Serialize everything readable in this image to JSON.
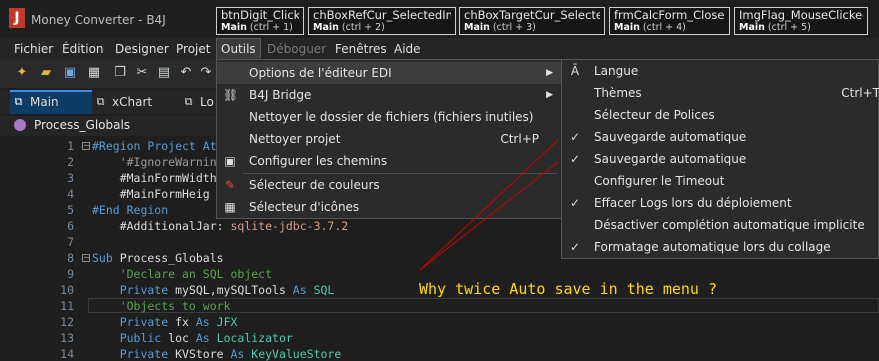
{
  "app": {
    "logo": "J",
    "title": "Money Converter - B4J"
  },
  "quick_tabs": [
    {
      "name": "btnDigit_Click",
      "module": "Main",
      "shortcut": "(ctrl + 1)"
    },
    {
      "name": "chBoxRefCur_SelectedInd",
      "module": "Main",
      "shortcut": "(ctrl + 2)"
    },
    {
      "name": "chBoxTargetCur_SelectedI",
      "module": "Main",
      "shortcut": "(ctrl + 3)"
    },
    {
      "name": "frmCalcForm_Closed",
      "module": "Main",
      "shortcut": "(ctrl + 4)"
    },
    {
      "name": "ImgFlag_MouseClicked",
      "module": "Main",
      "shortcut": "(ctrl + 5)"
    }
  ],
  "menubar": [
    "Fichier",
    "Édition",
    "Designer",
    "Projet",
    "Outils",
    "Déboguer",
    "Fenêtres",
    "Aide"
  ],
  "doc_tabs": [
    "Main",
    "xChart",
    "Lo"
  ],
  "module_name": "Process_Globals",
  "tools_menu": [
    {
      "label": "Options de l'éditeur EDI",
      "submenu": true
    },
    {
      "label": "B4J Bridge",
      "submenu": true,
      "icon": "link-icon"
    },
    {
      "label": "Nettoyer le dossier de fichiers (fichiers inutiles)"
    },
    {
      "label": "Nettoyer projet",
      "shortcut": "Ctrl+P"
    },
    {
      "label": "Configurer les chemins",
      "icon": "paths-icon"
    },
    {
      "label": "Sélecteur de couleurs",
      "icon": "color-picker-icon"
    },
    {
      "label": "Sélecteur d'icônes",
      "icon": "icon-picker-icon"
    }
  ],
  "options_submenu": [
    {
      "label": "Langue",
      "checked": false,
      "icon": "language-icon"
    },
    {
      "label": "Thèmes",
      "checked": false,
      "shortcut": "Ctrl+T"
    },
    {
      "label": "Sélecteur de Polices",
      "checked": false
    },
    {
      "label": "Sauvegarde automatique",
      "checked": true
    },
    {
      "label": "Sauvegarde automatique",
      "checked": true
    },
    {
      "label": "Configurer le Timeout",
      "checked": false
    },
    {
      "label": "Effacer Logs lors du déploiement",
      "checked": true
    },
    {
      "label": "Désactiver complétion automatique implicite",
      "checked": false
    },
    {
      "label": "Formatage automatique lors du collage",
      "checked": true
    }
  ],
  "code_lines": [
    {
      "n": "1",
      "tokens": [
        [
          "#Region ",
          "kw"
        ],
        [
          "Project At",
          "kw"
        ]
      ]
    },
    {
      "n": "2",
      "tokens": [
        [
          "    '#IgnoreWarnin",
          "pp"
        ]
      ]
    },
    {
      "n": "3",
      "tokens": [
        [
          "    #MainFormWidth",
          "pl"
        ]
      ]
    },
    {
      "n": "4",
      "tokens": [
        [
          "    #MainFormHeig",
          "pl"
        ]
      ]
    },
    {
      "n": "5",
      "tokens": [
        [
          "#End Region",
          "kw"
        ]
      ]
    },
    {
      "n": "6",
      "tokens": [
        [
          "    #AdditionalJar: ",
          "pl"
        ],
        [
          "sqlite-jdbc-3.7.2",
          "str"
        ]
      ]
    },
    {
      "n": "7",
      "tokens": []
    },
    {
      "n": "8",
      "tokens": [
        [
          "Sub ",
          "kw"
        ],
        [
          "Process_Globals",
          "pl"
        ]
      ]
    },
    {
      "n": "9",
      "tokens": [
        [
          "    'Declare an SQL object",
          "cm"
        ]
      ]
    },
    {
      "n": "10",
      "tokens": [
        [
          "    Private ",
          "kw"
        ],
        [
          "mySQL,mySQLTools ",
          "pl"
        ],
        [
          "As ",
          "kw"
        ],
        [
          "SQL",
          "ty"
        ]
      ]
    },
    {
      "n": "11",
      "tokens": [
        [
          "    'Objects to work",
          "cm"
        ]
      ]
    },
    {
      "n": "12",
      "tokens": [
        [
          "    Private ",
          "kw"
        ],
        [
          "fx ",
          "pl"
        ],
        [
          "As ",
          "kw"
        ],
        [
          "JFX",
          "ty"
        ]
      ]
    },
    {
      "n": "13",
      "tokens": [
        [
          "    Public ",
          "kw"
        ],
        [
          "loc ",
          "pl"
        ],
        [
          "As ",
          "kw"
        ],
        [
          "Localizator",
          "ty"
        ]
      ]
    },
    {
      "n": "14",
      "tokens": [
        [
          "    Private ",
          "kw"
        ],
        [
          "KVStore ",
          "pl"
        ],
        [
          "As ",
          "kw"
        ],
        [
          "KeyValueStore",
          "ty"
        ]
      ]
    }
  ],
  "annotation": "Why twice Auto save in the menu ?",
  "colors": {
    "annotation": "#ffd800",
    "arrows": "#cc0000",
    "accent_tab": "#0e3a66"
  }
}
